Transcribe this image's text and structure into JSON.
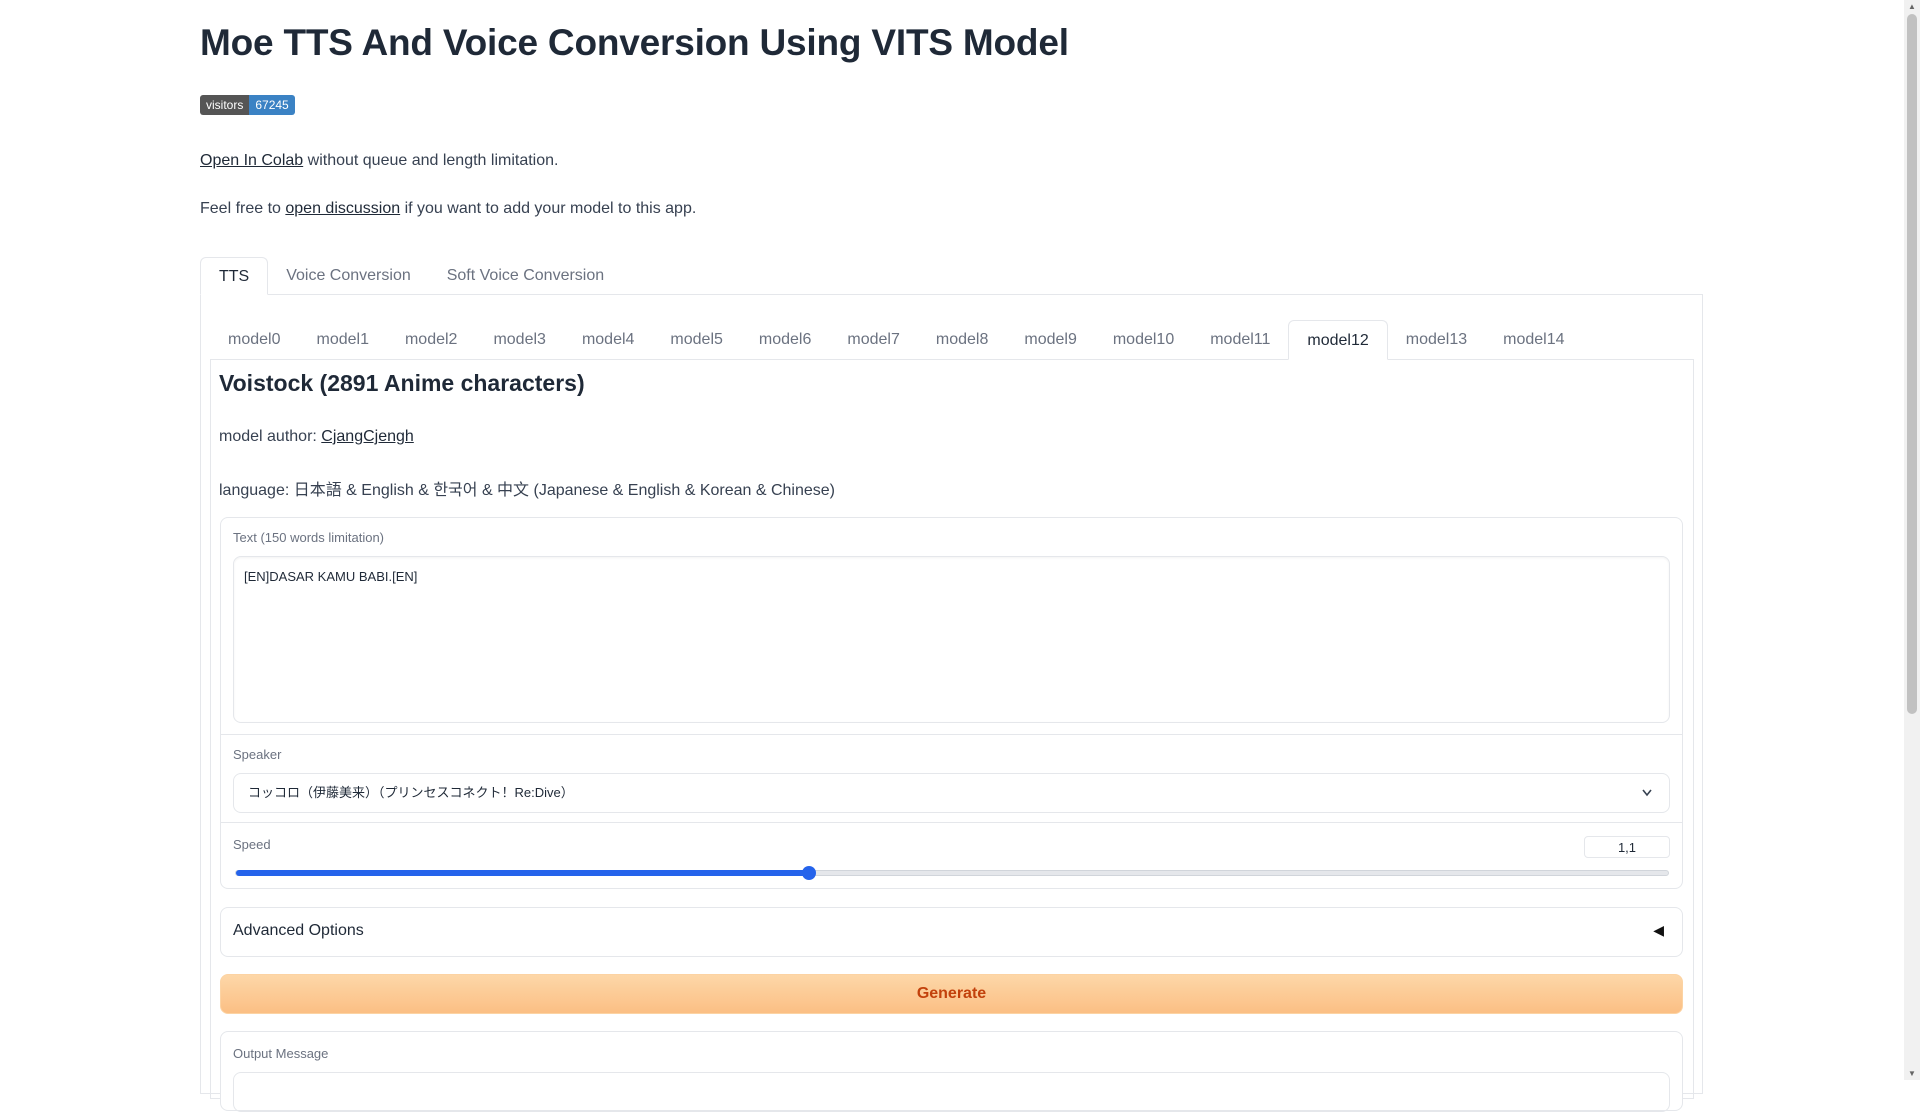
{
  "header": {
    "title": "Moe TTS And Voice Conversion Using VITS Model",
    "badge": {
      "label": "visitors",
      "count": "67245"
    }
  },
  "intro": {
    "line1_link": "Open In Colab",
    "line1_rest": " without queue and length limitation.",
    "line2_prefix": "Feel free to ",
    "line2_link": "open discussion",
    "line2_rest": " if you want to add your model to this app."
  },
  "main_tabs": [
    {
      "label": "TTS",
      "active": true
    },
    {
      "label": "Voice Conversion",
      "active": false
    },
    {
      "label": "Soft Voice Conversion",
      "active": false
    }
  ],
  "model_tabs": [
    "model0",
    "model1",
    "model2",
    "model3",
    "model4",
    "model5",
    "model6",
    "model7",
    "model8",
    "model9",
    "model10",
    "model11",
    "model12",
    "model13",
    "model14"
  ],
  "active_model_tab": "model12",
  "model": {
    "name": "Voistock (2891 Anime characters)",
    "author_label": "model author: ",
    "author": "CjangCjengh",
    "language": "language: 日本語 & English & 한국어 & 中文 (Japanese & English & Korean & Chinese)"
  },
  "text_field": {
    "label": "Text (150 words limitation)",
    "value": "[EN]DASAR KAMU BABI.[EN]"
  },
  "speaker": {
    "label": "Speaker",
    "selected": "コッコロ（伊藤美来）（プリンセスコネクト！Re:Dive）",
    "chevron_icon": "chevron-down-icon"
  },
  "speed": {
    "label": "Speed",
    "value": "1,1",
    "fraction": 0.4
  },
  "advanced": {
    "label": "Advanced Options",
    "caret": "◀"
  },
  "generate_label": "Generate",
  "output": {
    "label": "Output Message"
  },
  "colors": {
    "accent": "#2563eb",
    "generate_text": "#c2410c",
    "generate_bg": "#fbbf84"
  }
}
